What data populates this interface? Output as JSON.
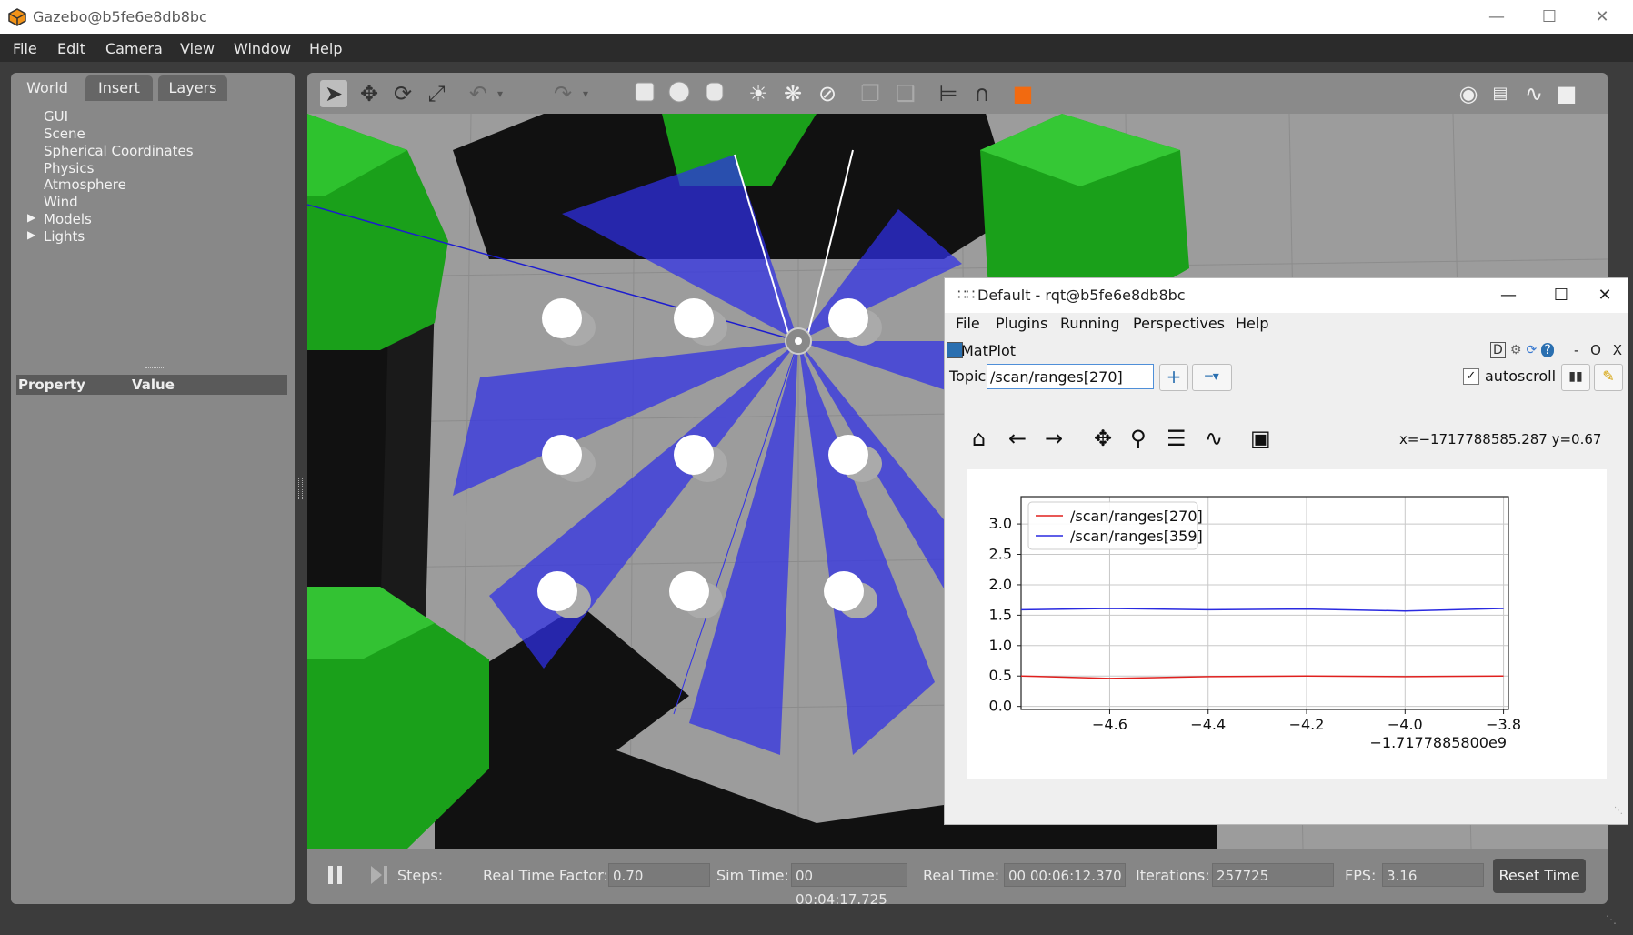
{
  "window": {
    "title": "Gazebo@b5fe6e8db8bc"
  },
  "menu": {
    "items": [
      "File",
      "Edit",
      "Camera",
      "View",
      "Window",
      "Help"
    ]
  },
  "left_panel": {
    "tabs": [
      "World",
      "Insert",
      "Layers"
    ],
    "tree_items": [
      "GUI",
      "Scene",
      "Spherical Coordinates",
      "Physics",
      "Atmosphere",
      "Wind",
      "Models",
      "Lights"
    ],
    "property_header": {
      "property": "Property",
      "value": "Value"
    }
  },
  "toolbar": {
    "tools": [
      "select-arrow-icon",
      "translate-icon",
      "rotate-icon",
      "scale-icon",
      "undo-icon",
      "redo-icon",
      "box-icon",
      "sphere-icon",
      "cylinder-icon",
      "point-light-icon",
      "spot-light-icon",
      "directional-light-icon",
      "copy-icon",
      "paste-icon",
      "align-icon",
      "magnet-icon",
      "view-angle-icon",
      "screenshot-icon",
      "log-icon",
      "plot-icon",
      "record-video-icon"
    ]
  },
  "bottom_bar": {
    "steps_label": "Steps:",
    "rtf_label": "Real Time Factor:",
    "rtf_value": "0.70",
    "sim_time_label": "Sim Time:",
    "sim_time_value": "00 00:04:17.725",
    "real_time_label": "Real Time:",
    "real_time_value": "00 00:06:12.370",
    "iterations_label": "Iterations:",
    "iterations_value": "257725",
    "fps_label": "FPS:",
    "fps_value": "3.16",
    "reset_label": "Reset Time"
  },
  "rqt": {
    "title": "Default - rqt@b5fe6e8db8bc",
    "menu": [
      "File",
      "Plugins",
      "Running",
      "Perspectives",
      "Help"
    ],
    "plugin_name": "MatPlot",
    "plugin_controls": "- O X",
    "topic_label": "Topic",
    "topic_value": "/scan/ranges[270]",
    "autoscroll_label": "autoscroll",
    "autoscroll_checked": true,
    "coord_readout": "x=−1717788585.287 y=0.67"
  },
  "chart_data": {
    "type": "line",
    "x_offset_label": "−1.7177885800e9",
    "x_ticks": [
      "−4.6",
      "−4.4",
      "−4.2",
      "−4.0",
      "−3.8"
    ],
    "y_ticks": [
      "0.0",
      "0.5",
      "1.0",
      "1.5",
      "2.0",
      "2.5",
      "3.0"
    ],
    "xlim": [
      -4.78,
      -3.79
    ],
    "ylim": [
      -0.05,
      3.45
    ],
    "legend_position": "upper-left",
    "grid": true,
    "series": [
      {
        "name": "/scan/ranges[270]",
        "color": "#e0201e",
        "x": [
          -4.78,
          -4.6,
          -4.4,
          -4.2,
          -4.0,
          -3.8
        ],
        "y": [
          0.5,
          0.46,
          0.49,
          0.5,
          0.49,
          0.5
        ]
      },
      {
        "name": "/scan/ranges[359]",
        "color": "#2a2ae0",
        "x": [
          -4.78,
          -4.6,
          -4.4,
          -4.2,
          -4.0,
          -3.8
        ],
        "y": [
          1.59,
          1.61,
          1.59,
          1.6,
          1.57,
          1.61
        ]
      }
    ]
  }
}
